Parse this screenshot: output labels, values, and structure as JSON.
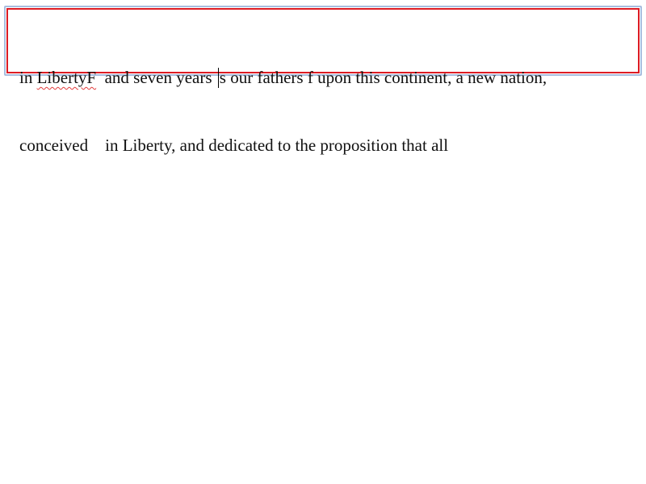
{
  "editor": {
    "line1": {
      "prefix": "in ",
      "misspelled": "LibertyF",
      "before_caret": "  and seven years ",
      "after_caret": "s our fathers f upon this continent, a new nation,"
    },
    "line2": {
      "text": "conceived    in Liberty, and dedicated to the proposition that all"
    }
  },
  "colors": {
    "outer_border": "#a8bedf",
    "inner_border": "#dd1c24",
    "spellcheck_underline": "#e23b3b"
  }
}
